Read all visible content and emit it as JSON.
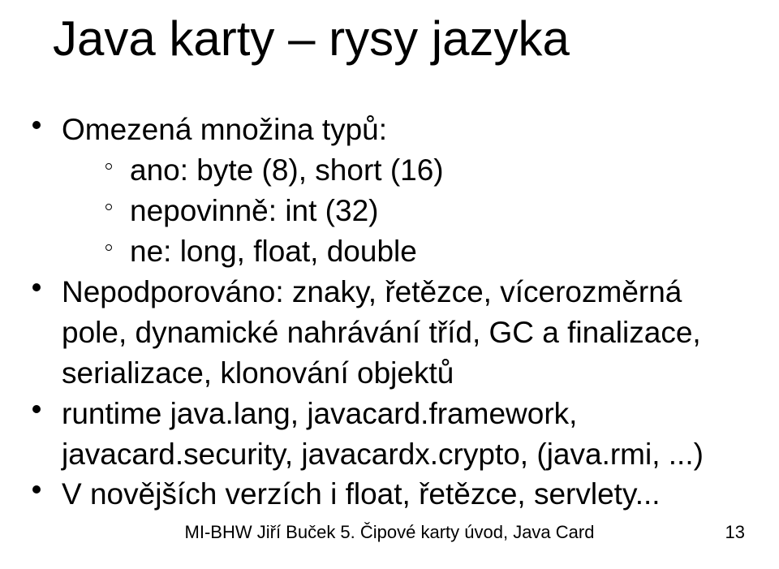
{
  "title": "Java karty – rysy jazyka",
  "bullets": {
    "b1": "Omezená množina typů:",
    "b1_sub": {
      "s1": "ano: byte (8), short (16)",
      "s2": "nepovinně: int (32)",
      "s3": "ne: long, float, double"
    },
    "b2": "Nepodporováno: znaky, řetězce, vícerozměrná pole, dynamické nahrávání tříd, GC a finalizace, serializace, klonování objektů",
    "b3": "runtime java.lang, javacard.framework, javacard.security, javacardx.crypto, (java.rmi, ...)",
    "b4": "V novějších verzích i float, řetězce, servlety..."
  },
  "footer": "MI-BHW   Jiří Buček   5. Čipové karty úvod, Java Card",
  "page": "13"
}
